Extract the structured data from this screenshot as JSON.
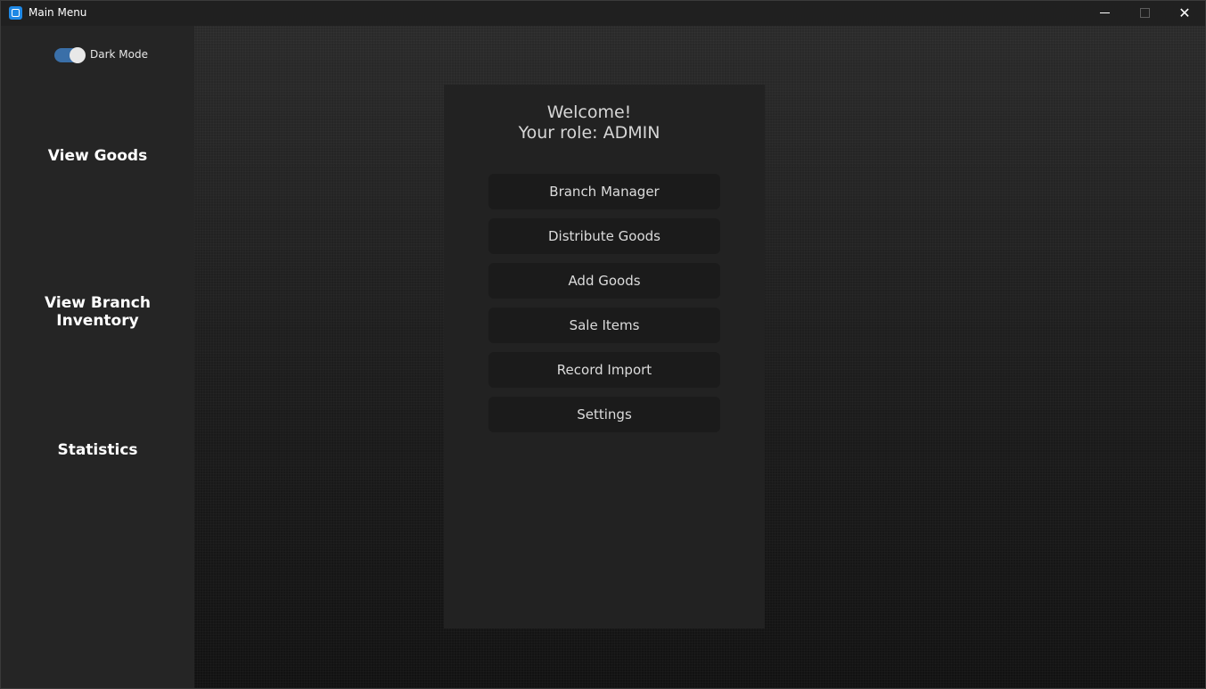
{
  "window": {
    "title": "Main Menu",
    "minimize_icon": "minimize-icon",
    "maximize_icon": "maximize-icon",
    "close_glyph": "✕"
  },
  "sidebar": {
    "dark_mode_label": "Dark Mode",
    "dark_mode_on": true,
    "items": [
      {
        "label": "View Goods"
      },
      {
        "label": "View Branch Inventory"
      },
      {
        "label": "Statistics"
      }
    ]
  },
  "panel": {
    "welcome_line1": "Welcome!",
    "welcome_line2": "Your role: ADMIN",
    "buttons": [
      {
        "label": "Branch Manager"
      },
      {
        "label": "Distribute Goods"
      },
      {
        "label": "Add Goods"
      },
      {
        "label": "Sale Items"
      },
      {
        "label": "Record Import"
      },
      {
        "label": "Settings"
      }
    ]
  },
  "colors": {
    "accent": "#3a6fa8",
    "app_icon": "#1e88e5",
    "sidebar_bg": "#252525",
    "panel_bg": "#222222",
    "button_bg": "#1b1b1b"
  }
}
